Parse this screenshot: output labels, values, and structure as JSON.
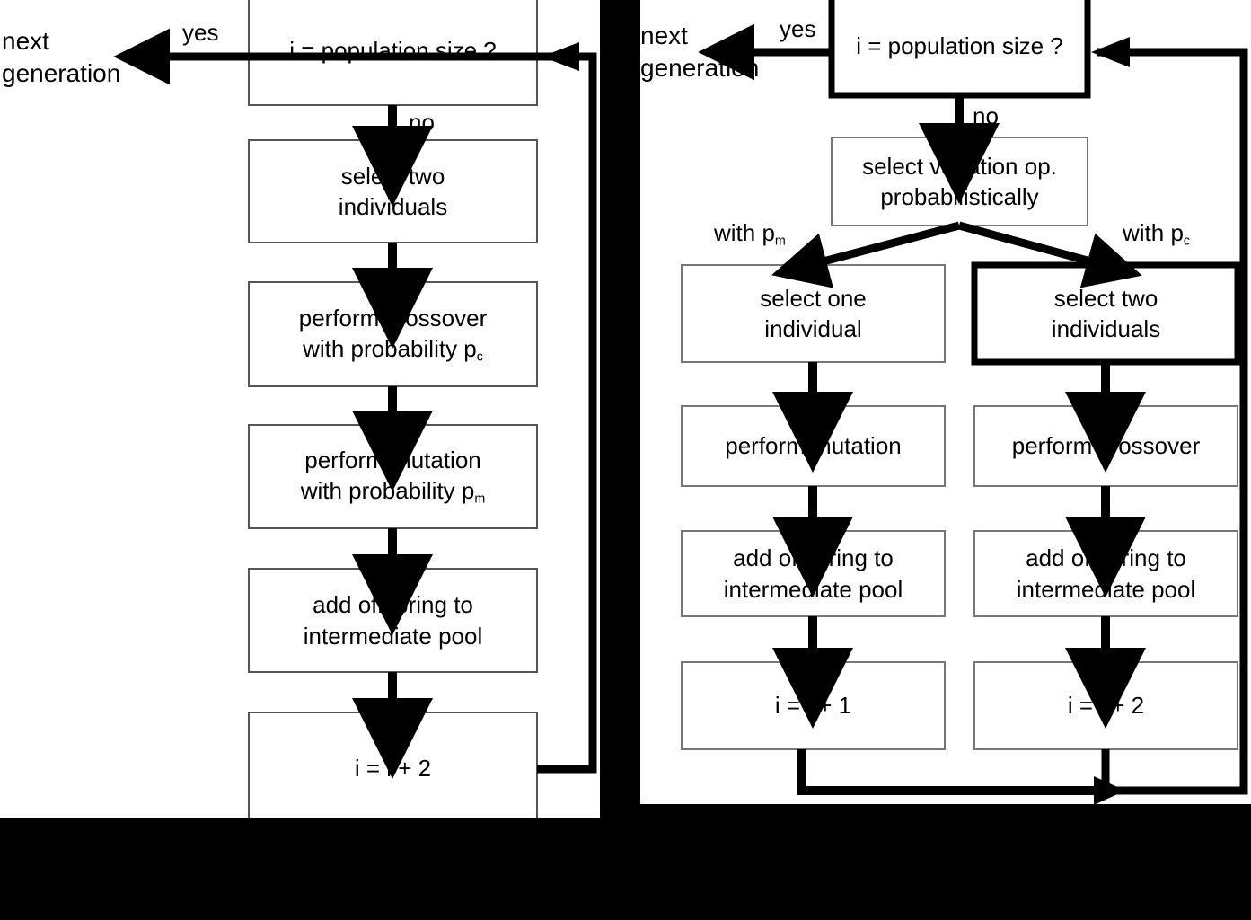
{
  "figure": {
    "type": "flowchart",
    "description": "Two side-by-side evolutionary algorithm inner-loop flowcharts",
    "colors": {
      "background": "#000000",
      "panel": "#ffffff",
      "stroke": "#000000"
    }
  },
  "left_panel": {
    "name": "traditional-variation-loop",
    "exit_label_line1": "next",
    "exit_label_line2": "generation",
    "yes_label": "yes",
    "no_label": "no",
    "nodes": [
      {
        "id": "decision",
        "lines": [
          "i = population size ?"
        ],
        "emphasis": "thin"
      },
      {
        "id": "select",
        "lines": [
          "select two",
          "individuals"
        ],
        "emphasis": "thin"
      },
      {
        "id": "crossover",
        "lines": [
          "perform crossover",
          "with probability p"
        ],
        "sub": "c",
        "emphasis": "thin"
      },
      {
        "id": "mutation",
        "lines": [
          "perform mutation",
          "with probability p"
        ],
        "sub": "m",
        "emphasis": "thin"
      },
      {
        "id": "addpool",
        "lines": [
          "add offspring to",
          "intermediate pool"
        ],
        "emphasis": "thin"
      },
      {
        "id": "increment",
        "lines": [
          "i = i + 2"
        ],
        "emphasis": "thin"
      }
    ]
  },
  "right_panel": {
    "name": "probabilistic-variation-loop",
    "exit_label_line1": "next",
    "exit_label_line2": "generation",
    "yes_label": "yes",
    "no_label": "no",
    "branch_label_left": "with p",
    "branch_label_left_sub": "m",
    "branch_label_right": "with p",
    "branch_label_right_sub": "c",
    "nodes": [
      {
        "id": "decision",
        "lines": [
          "i = population size ?"
        ],
        "emphasis": "thick"
      },
      {
        "id": "selectop",
        "lines": [
          "select variation op.",
          "probabilistically"
        ],
        "emphasis": "thin"
      },
      {
        "id": "select-one",
        "lines": [
          "select one",
          "individual"
        ],
        "emphasis": "thin"
      },
      {
        "id": "select-two",
        "lines": [
          "select two",
          "individuals"
        ],
        "emphasis": "thick"
      },
      {
        "id": "mutation",
        "lines": [
          "perform mutation"
        ],
        "emphasis": "thin"
      },
      {
        "id": "crossover",
        "lines": [
          "perform crossover"
        ],
        "emphasis": "thin"
      },
      {
        "id": "addpool-left",
        "lines": [
          "add offspring to",
          "intermediate pool"
        ],
        "emphasis": "thin"
      },
      {
        "id": "addpool-right",
        "lines": [
          "add offspring to",
          "intermediate pool"
        ],
        "emphasis": "thin"
      },
      {
        "id": "inc-left",
        "lines": [
          "i = i + 1"
        ],
        "emphasis": "thin"
      },
      {
        "id": "inc-right",
        "lines": [
          "i = i + 2"
        ],
        "emphasis": "thin"
      }
    ]
  }
}
